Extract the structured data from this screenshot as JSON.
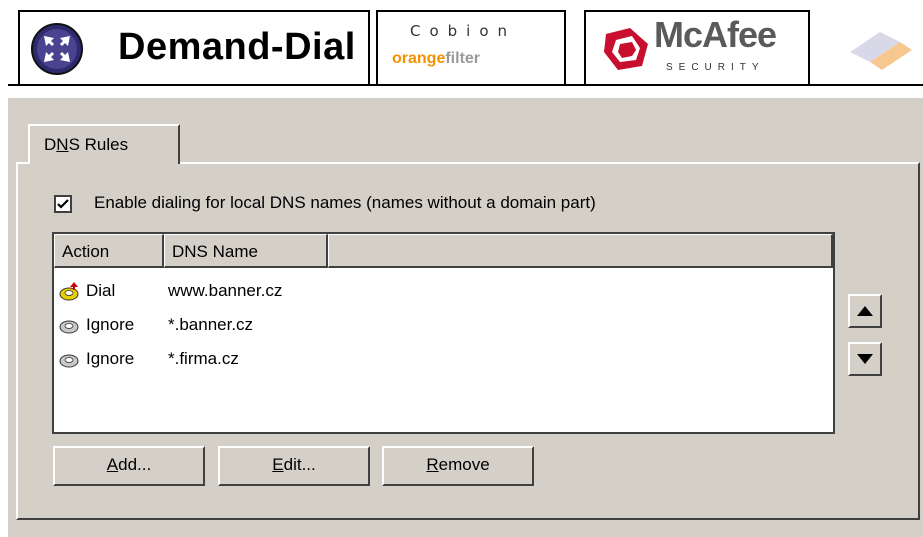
{
  "header": {
    "title": "Demand-Dial",
    "cobion": {
      "brand": "Cobion",
      "product_part1": "orange",
      "product_part2": "filter"
    },
    "mcafee": {
      "brand": "McAfee",
      "sub": "SECURITY"
    }
  },
  "tab": {
    "label_pre": "D",
    "label_accel": "N",
    "label_post": "S Rules"
  },
  "enable_checkbox": {
    "checked": true,
    "label": "Enable dialing for local DNS names (names without a domain part)"
  },
  "list": {
    "columns": [
      "Action",
      "DNS Name",
      ""
    ],
    "rows": [
      {
        "icon": "dial-phone-icon",
        "action": "Dial",
        "dns": "www.banner.cz"
      },
      {
        "icon": "ignore-phone-icon",
        "action": "Ignore",
        "dns": "*.banner.cz"
      },
      {
        "icon": "ignore-phone-icon",
        "action": "Ignore",
        "dns": "*.firma.cz"
      }
    ]
  },
  "buttons": {
    "add": {
      "accel": "A",
      "rest": "dd..."
    },
    "edit": {
      "accel": "E",
      "rest": "dit..."
    },
    "remove": {
      "accel": "R",
      "rest": "emove"
    }
  },
  "colors": {
    "panel": "#d4d0c8",
    "orange": "#f39200"
  }
}
